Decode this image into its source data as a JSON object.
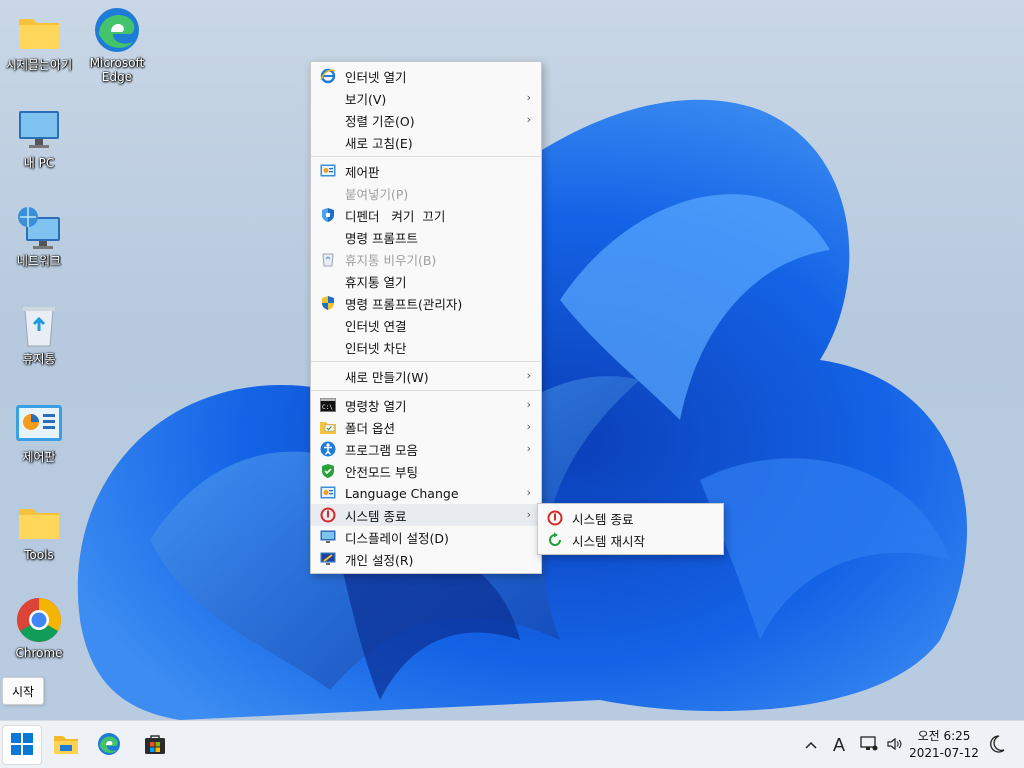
{
  "desktop": {
    "icons": [
      {
        "label": "시제믈는아기",
        "icon": "folder-icon"
      },
      {
        "label": "Microsoft Edge",
        "icon": "edge-icon"
      },
      {
        "label": "내 PC",
        "icon": "monitor-icon"
      },
      {
        "label": "네트워크",
        "icon": "network-icon"
      },
      {
        "label": "휴지통",
        "icon": "recycle-bin-icon"
      },
      {
        "label": "제어판",
        "icon": "control-panel-icon"
      },
      {
        "label": "Tools",
        "icon": "folder-icon"
      },
      {
        "label": "Chrome",
        "icon": "chrome-icon"
      }
    ]
  },
  "context_menu": {
    "items": [
      {
        "label": "인터넷 열기",
        "icon": "internet-explorer-icon"
      },
      {
        "label": "보기(V)",
        "submenu": true
      },
      {
        "label": "정렬 기준(O)",
        "submenu": true
      },
      {
        "label": "새로 고침(E)"
      },
      {
        "label": "제어판",
        "icon": "control-panel-icon"
      },
      {
        "label": "붙여넣기(P)",
        "disabled": true
      },
      {
        "label": "디펜더   켜기  끄기",
        "icon": "defender-shield-icon"
      },
      {
        "label": "명령 프롬프트"
      },
      {
        "label": "휴지통 비우기(B)",
        "icon": "recycle-bin-icon",
        "disabled": true
      },
      {
        "label": "휴지통 열기"
      },
      {
        "label": "명령 프롬프트(관리자)",
        "icon": "uac-shield-icon"
      },
      {
        "label": "인터넷 연결"
      },
      {
        "label": "인터넷 차단"
      },
      {
        "label": "새로 만들기(W)",
        "submenu": true
      },
      {
        "label": "명령창 열기",
        "icon": "command-prompt-icon",
        "submenu": true
      },
      {
        "label": "폴더 옵션",
        "icon": "folder-options-icon",
        "submenu": true
      },
      {
        "label": "프로그램 모음",
        "icon": "accessibility-icon",
        "submenu": true
      },
      {
        "label": "안전모드 부팅",
        "icon": "safe-mode-shield-icon"
      },
      {
        "label": "Language Change",
        "icon": "control-panel-icon",
        "submenu": true
      },
      {
        "label": "시스템 종료",
        "icon": "power-icon",
        "submenu": true,
        "active": true
      },
      {
        "label": "디스플레이 설정(D)",
        "icon": "display-icon"
      },
      {
        "label": "개인 설정(R)",
        "icon": "personalize-icon"
      }
    ]
  },
  "submenu": {
    "items": [
      {
        "label": "시스템 종료",
        "icon": "power-icon"
      },
      {
        "label": "시스템 재시작",
        "icon": "restart-icon"
      }
    ]
  },
  "tooltip": {
    "text": "시작"
  },
  "taskbar": {
    "buttons": [
      "start-button",
      "file-explorer-button",
      "edge-button",
      "store-button"
    ],
    "ime": "A",
    "time": "오전 6:25",
    "date": "2021-07-12"
  },
  "colors": {
    "accent": "#0a58d6",
    "power_red": "#d42a2a",
    "restart_green": "#1f9d3a"
  }
}
